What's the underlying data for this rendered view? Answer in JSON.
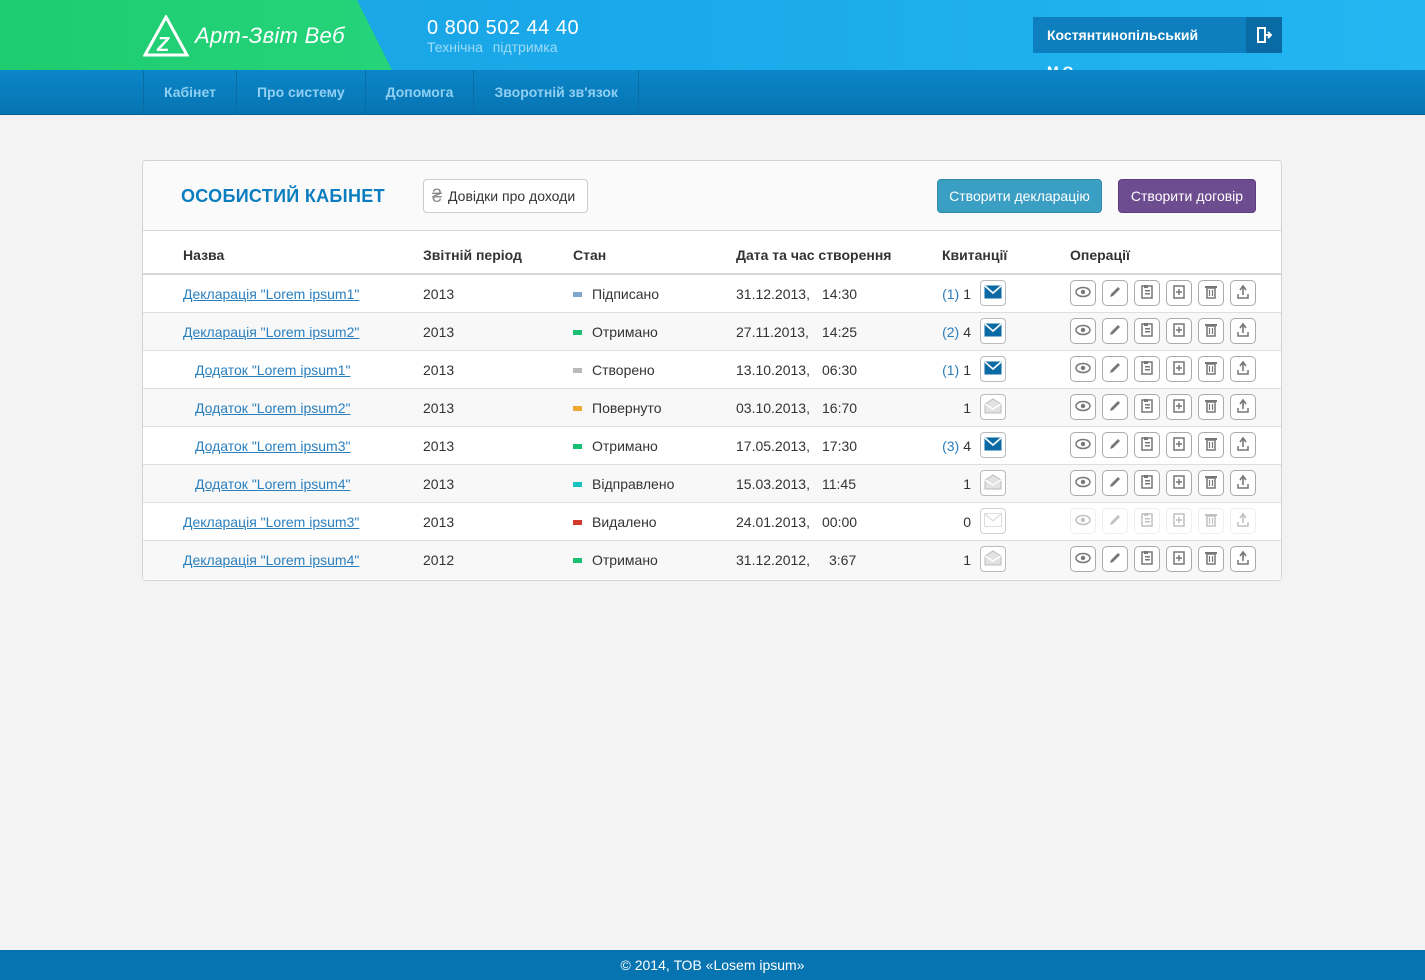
{
  "header": {
    "logo_text": "Арт-Звіт Веб",
    "phone": "0 800 502 44 40",
    "support": "Технічна підтримка",
    "user_name": "Костянтинопільський М.О."
  },
  "nav": {
    "items": [
      "Кабінет",
      "Про систему",
      "Допомога",
      "Зворотній зв'язок"
    ]
  },
  "panel": {
    "title": "ОСОБИСТИЙ КАБІНЕТ",
    "income_button": "Довідки про доходи",
    "create_declaration": "Створити декларацію",
    "create_contract": "Створити договір"
  },
  "table": {
    "headers": {
      "name": "Назва",
      "period": "Звітній період",
      "state": "Стан",
      "created": "Дата та час створення",
      "receipts": "Квитанції",
      "operations": "Операції"
    },
    "rows": [
      {
        "name": "Декларація \"Lorem ipsum1\"",
        "period": "2013",
        "state": "Підписано",
        "date": "31.12.2013,",
        "time": "14:30",
        "receipt_link": "(1)",
        "receipt_count": "1",
        "mail": "closed"
      },
      {
        "name": "Декларація \"Lorem ipsum2\"",
        "period": "2013",
        "state": "Отримано",
        "date": "27.11.2013,",
        "time": "14:25",
        "receipt_link": "(2)",
        "receipt_count": "4",
        "mail": "closed"
      },
      {
        "name": "Додаток \"Lorem ipsum1\"",
        "period": "2013",
        "state": "Створено",
        "date": "13.10.2013,",
        "time": "06:30",
        "receipt_link": "(1)",
        "receipt_count": "1",
        "mail": "closed"
      },
      {
        "name": "Додаток \"Lorem ipsum2\"",
        "period": "2013",
        "state": "Повернуто",
        "date": "03.10.2013,",
        "time": "16:70",
        "receipt_link": "",
        "receipt_count": "1",
        "mail": "open"
      },
      {
        "name": "Додаток \"Lorem ipsum3\"",
        "period": "2013",
        "state": "Отримано",
        "date": "17.05.2013,",
        "time": "17:30",
        "receipt_link": "(3)",
        "receipt_count": "4",
        "mail": "closed"
      },
      {
        "name": "Додаток \"Lorem ipsum4\"",
        "period": "2013",
        "state": "Відправлено",
        "date": "15.03.2013,",
        "time": "11:45",
        "receipt_link": "",
        "receipt_count": "1",
        "mail": "open"
      },
      {
        "name": "Декларація \"Lorem ipsum3\"",
        "period": "2013",
        "state": "Видалено",
        "date": "24.01.2013,",
        "time": "00:00",
        "receipt_link": "",
        "receipt_count": "0",
        "mail": "empty"
      },
      {
        "name": "Декларація \"Lorem ipsum4\"",
        "period": "2012",
        "state": "Отримано",
        "date": "31.12.2012,",
        "time": "3:67",
        "receipt_link": "",
        "receipt_count": "1",
        "mail": "open"
      }
    ]
  },
  "status_colors": {
    "Підписано": "#7ea7c9",
    "Отримано": "#1bbf73",
    "Створено": "#b9b9b9",
    "Повернуто": "#f0a830",
    "Відправлено": "#19c2c2",
    "Видалено": "#d0392b"
  },
  "icons": {
    "operations": [
      "view-icon",
      "edit-icon",
      "copy-doc-icon",
      "add-doc-icon",
      "trash-icon",
      "upload-icon"
    ]
  },
  "footer": {
    "copyright": "© 2014, ТОВ «Losem ipsum»"
  }
}
